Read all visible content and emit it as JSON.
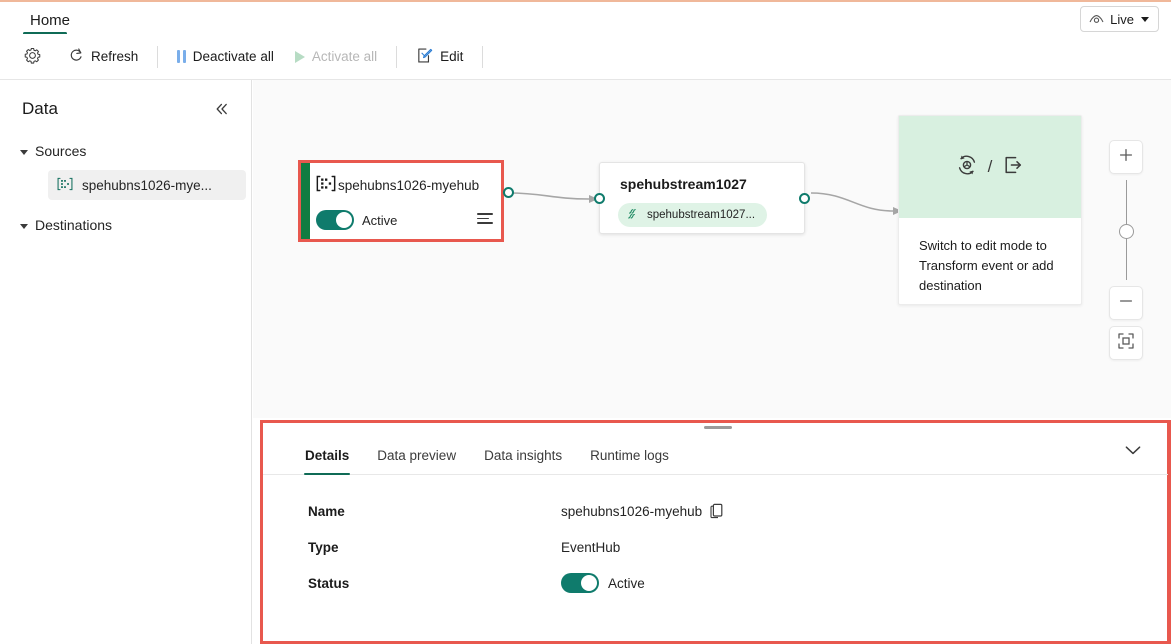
{
  "tabstrip": {
    "home_tab": "Home",
    "live_button": {
      "label": "Live",
      "icon": "eye-icon"
    }
  },
  "commandbar": {
    "settings": {
      "icon": "gear-icon",
      "label": ""
    },
    "refresh": {
      "icon": "refresh-icon",
      "label": "Refresh"
    },
    "deactivate_all": {
      "icon": "pause-icon",
      "label": "Deactivate all"
    },
    "activate_all": {
      "icon": "play-icon",
      "label": "Activate all",
      "disabled": true
    },
    "edit": {
      "icon": "edit-pencil-icon",
      "label": "Edit"
    }
  },
  "sidebar": {
    "title": "Data",
    "collapse_icon": "chevron-double-left-icon",
    "groups": [
      {
        "label": "Sources",
        "icon": "chevron-down-icon"
      },
      {
        "label": "Destinations",
        "icon": "chevron-down-icon"
      }
    ],
    "source_item": {
      "label": "spehubns1026-mye...",
      "icon": "eventhub-icon"
    }
  },
  "canvas": {
    "source_node": {
      "title": "spehubns1026-myehub",
      "icon": "eventhub-icon",
      "status_label": "Active",
      "status_on": true,
      "menu_icon": "more-lines-icon",
      "accent_color": "#107c41",
      "highlight_color": "#e8584e"
    },
    "stream_node": {
      "title": "spehubstream1027",
      "pill_label": "spehubstream1027...",
      "pill_icon": "eventstream-icon"
    },
    "hint_card": {
      "icon_transform": "transform-icon",
      "separator": "/",
      "icon_destination": "export-arrow-icon",
      "text": "Switch to edit mode to Transform event or add destination"
    },
    "zoom_controls": {
      "zoom_in": "plus-icon",
      "zoom_out": "minus-icon",
      "fit_to_screen": "fit-screen-icon"
    }
  },
  "details_panel": {
    "tabs": [
      {
        "label": "Details",
        "active": true
      },
      {
        "label": "Data preview",
        "active": false
      },
      {
        "label": "Data insights",
        "active": false
      },
      {
        "label": "Runtime logs",
        "active": false
      }
    ],
    "collapse_icon": "chevron-down-icon",
    "rows": [
      {
        "label": "Name",
        "value": "spehubns1026-myehub",
        "copy": true
      },
      {
        "label": "Type",
        "value": "EventHub",
        "copy": false
      },
      {
        "label": "Status",
        "value": "Active",
        "toggle": true
      }
    ]
  }
}
